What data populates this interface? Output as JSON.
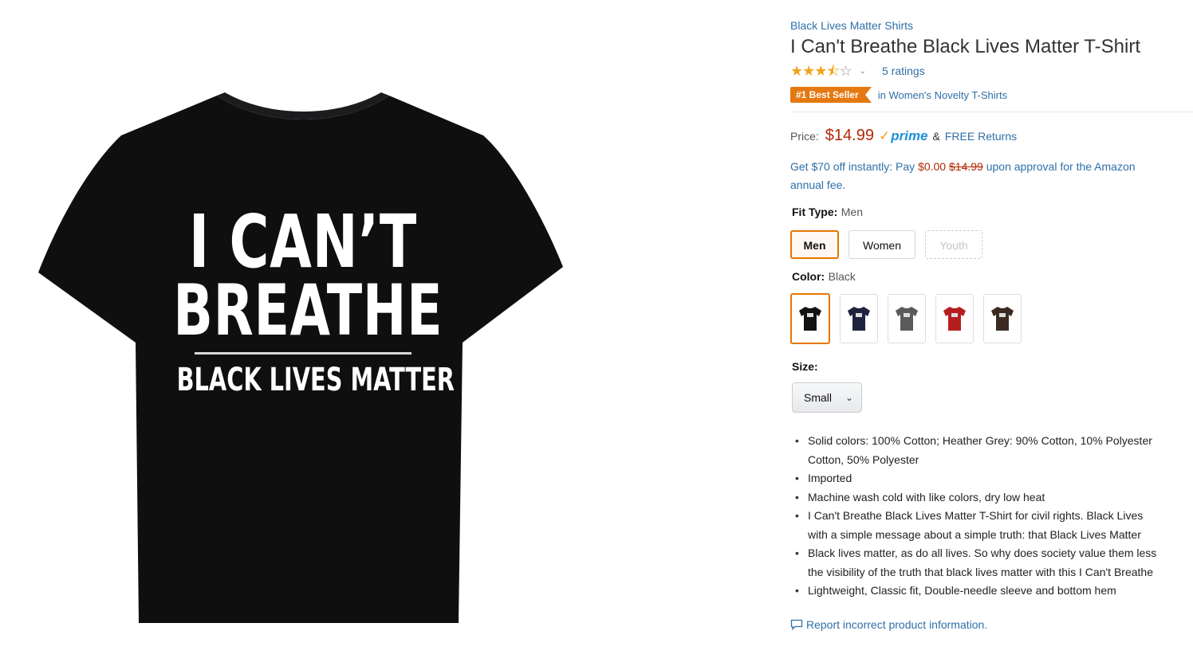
{
  "product_image": {
    "print_line1": "I CAN’T",
    "print_line2": "BREATHE",
    "print_line3": "BLACK LIVES MATTER",
    "shirt_color": "#0f0f10"
  },
  "brand_link": "Black Lives Matter Shirts",
  "title": "I Can't Breathe Black Lives Matter T-Shirt",
  "rating": {
    "stars": 3.5,
    "ratings_link": "5 ratings"
  },
  "best_seller": {
    "badge": "#1 Best Seller",
    "category": "in Women's Novelty T-Shirts"
  },
  "price": {
    "label": "Price:",
    "value": "$14.99",
    "prime": "prime",
    "amp": "&",
    "free_returns": "FREE Returns"
  },
  "promo": {
    "part1": "Get $70 off instantly: Pay ",
    "pay": "$0.00",
    "strike": "$14.99",
    "part2": " upon approval for the Amazon",
    "line2": "annual fee."
  },
  "fit_type": {
    "label": "Fit Type:",
    "selected": "Men",
    "options": [
      "Men",
      "Women",
      "Youth"
    ]
  },
  "color": {
    "label": "Color:",
    "selected": "Black",
    "swatches": [
      "#111111",
      "#1f2340",
      "#5a5a5a",
      "#b61e1e",
      "#3a2a22"
    ]
  },
  "size": {
    "label": "Size:",
    "selected": "Small"
  },
  "bullets": [
    {
      "l1": "Solid colors: 100% Cotton; Heather Grey: 90% Cotton, 10% Polyester",
      "l2": "Cotton, 50% Polyester"
    },
    {
      "l1": "Imported",
      "l2": ""
    },
    {
      "l1": "Machine wash cold with like colors, dry low heat",
      "l2": ""
    },
    {
      "l1": "I Can't Breathe Black Lives Matter T-Shirt for civil rights. Black Lives",
      "l2": "with a simple message about a simple truth: that Black Lives Matter"
    },
    {
      "l1": "Black lives matter, as do all lives. So why does society value them less",
      "l2": "the visibility of the truth that black lives matter with this I Can't Breathe"
    },
    {
      "l1": "Lightweight, Classic fit, Double-needle sleeve and bottom hem",
      "l2": ""
    }
  ],
  "report_link": "Report incorrect product information."
}
